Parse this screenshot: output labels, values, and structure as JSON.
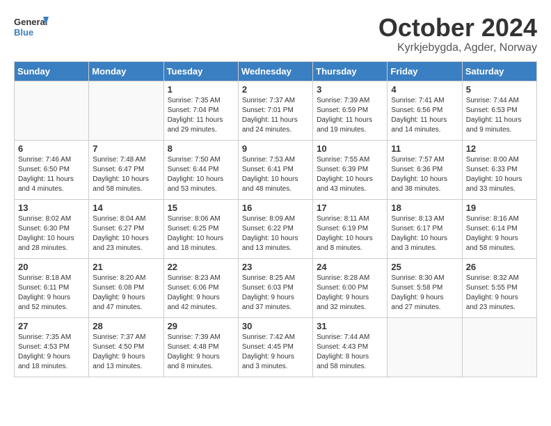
{
  "header": {
    "logo_general": "General",
    "logo_blue": "Blue",
    "month_title": "October 2024",
    "location": "Kyrkjebygda, Agder, Norway"
  },
  "calendar": {
    "days_of_week": [
      "Sunday",
      "Monday",
      "Tuesday",
      "Wednesday",
      "Thursday",
      "Friday",
      "Saturday"
    ],
    "weeks": [
      [
        {
          "day": "",
          "info": ""
        },
        {
          "day": "",
          "info": ""
        },
        {
          "day": "1",
          "info": "Sunrise: 7:35 AM\nSunset: 7:04 PM\nDaylight: 11 hours\nand 29 minutes."
        },
        {
          "day": "2",
          "info": "Sunrise: 7:37 AM\nSunset: 7:01 PM\nDaylight: 11 hours\nand 24 minutes."
        },
        {
          "day": "3",
          "info": "Sunrise: 7:39 AM\nSunset: 6:59 PM\nDaylight: 11 hours\nand 19 minutes."
        },
        {
          "day": "4",
          "info": "Sunrise: 7:41 AM\nSunset: 6:56 PM\nDaylight: 11 hours\nand 14 minutes."
        },
        {
          "day": "5",
          "info": "Sunrise: 7:44 AM\nSunset: 6:53 PM\nDaylight: 11 hours\nand 9 minutes."
        }
      ],
      [
        {
          "day": "6",
          "info": "Sunrise: 7:46 AM\nSunset: 6:50 PM\nDaylight: 11 hours\nand 4 minutes."
        },
        {
          "day": "7",
          "info": "Sunrise: 7:48 AM\nSunset: 6:47 PM\nDaylight: 10 hours\nand 58 minutes."
        },
        {
          "day": "8",
          "info": "Sunrise: 7:50 AM\nSunset: 6:44 PM\nDaylight: 10 hours\nand 53 minutes."
        },
        {
          "day": "9",
          "info": "Sunrise: 7:53 AM\nSunset: 6:41 PM\nDaylight: 10 hours\nand 48 minutes."
        },
        {
          "day": "10",
          "info": "Sunrise: 7:55 AM\nSunset: 6:39 PM\nDaylight: 10 hours\nand 43 minutes."
        },
        {
          "day": "11",
          "info": "Sunrise: 7:57 AM\nSunset: 6:36 PM\nDaylight: 10 hours\nand 38 minutes."
        },
        {
          "day": "12",
          "info": "Sunrise: 8:00 AM\nSunset: 6:33 PM\nDaylight: 10 hours\nand 33 minutes."
        }
      ],
      [
        {
          "day": "13",
          "info": "Sunrise: 8:02 AM\nSunset: 6:30 PM\nDaylight: 10 hours\nand 28 minutes."
        },
        {
          "day": "14",
          "info": "Sunrise: 8:04 AM\nSunset: 6:27 PM\nDaylight: 10 hours\nand 23 minutes."
        },
        {
          "day": "15",
          "info": "Sunrise: 8:06 AM\nSunset: 6:25 PM\nDaylight: 10 hours\nand 18 minutes."
        },
        {
          "day": "16",
          "info": "Sunrise: 8:09 AM\nSunset: 6:22 PM\nDaylight: 10 hours\nand 13 minutes."
        },
        {
          "day": "17",
          "info": "Sunrise: 8:11 AM\nSunset: 6:19 PM\nDaylight: 10 hours\nand 8 minutes."
        },
        {
          "day": "18",
          "info": "Sunrise: 8:13 AM\nSunset: 6:17 PM\nDaylight: 10 hours\nand 3 minutes."
        },
        {
          "day": "19",
          "info": "Sunrise: 8:16 AM\nSunset: 6:14 PM\nDaylight: 9 hours\nand 58 minutes."
        }
      ],
      [
        {
          "day": "20",
          "info": "Sunrise: 8:18 AM\nSunset: 6:11 PM\nDaylight: 9 hours\nand 52 minutes."
        },
        {
          "day": "21",
          "info": "Sunrise: 8:20 AM\nSunset: 6:08 PM\nDaylight: 9 hours\nand 47 minutes."
        },
        {
          "day": "22",
          "info": "Sunrise: 8:23 AM\nSunset: 6:06 PM\nDaylight: 9 hours\nand 42 minutes."
        },
        {
          "day": "23",
          "info": "Sunrise: 8:25 AM\nSunset: 6:03 PM\nDaylight: 9 hours\nand 37 minutes."
        },
        {
          "day": "24",
          "info": "Sunrise: 8:28 AM\nSunset: 6:00 PM\nDaylight: 9 hours\nand 32 minutes."
        },
        {
          "day": "25",
          "info": "Sunrise: 8:30 AM\nSunset: 5:58 PM\nDaylight: 9 hours\nand 27 minutes."
        },
        {
          "day": "26",
          "info": "Sunrise: 8:32 AM\nSunset: 5:55 PM\nDaylight: 9 hours\nand 23 minutes."
        }
      ],
      [
        {
          "day": "27",
          "info": "Sunrise: 7:35 AM\nSunset: 4:53 PM\nDaylight: 9 hours\nand 18 minutes."
        },
        {
          "day": "28",
          "info": "Sunrise: 7:37 AM\nSunset: 4:50 PM\nDaylight: 9 hours\nand 13 minutes."
        },
        {
          "day": "29",
          "info": "Sunrise: 7:39 AM\nSunset: 4:48 PM\nDaylight: 9 hours\nand 8 minutes."
        },
        {
          "day": "30",
          "info": "Sunrise: 7:42 AM\nSunset: 4:45 PM\nDaylight: 9 hours\nand 3 minutes."
        },
        {
          "day": "31",
          "info": "Sunrise: 7:44 AM\nSunset: 4:43 PM\nDaylight: 8 hours\nand 58 minutes."
        },
        {
          "day": "",
          "info": ""
        },
        {
          "day": "",
          "info": ""
        }
      ]
    ]
  }
}
